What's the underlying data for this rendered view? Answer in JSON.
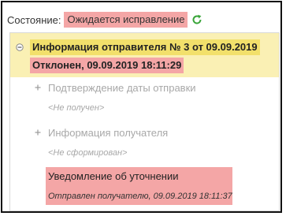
{
  "status": {
    "label": "Состояние:",
    "value": "Ожидается исправление",
    "value_bg": "#f4a6a6",
    "refresh_icon": "refresh-icon",
    "refresh_color": "#3aa53a"
  },
  "tree": {
    "sender": {
      "title": "Информация отправителя № 3 от 09.09.2019",
      "status": "Отклонен, 09.09.2019 18:11:29",
      "expanded": true,
      "head_bg": "#faf0b4",
      "title_bg": "#f2e06b",
      "status_bg": "#f4a6a6"
    },
    "nodes": [
      {
        "label": "Подтверждение даты отправки",
        "sub": "<Не получен>"
      },
      {
        "label": "Информация получателя",
        "sub": "<Не сформирован>"
      }
    ],
    "notice": {
      "label": "Уведомление об уточнении",
      "sub": "Отправлен получателю, 09.09.2019 18:11:37",
      "bg": "#f4a6a6"
    }
  }
}
